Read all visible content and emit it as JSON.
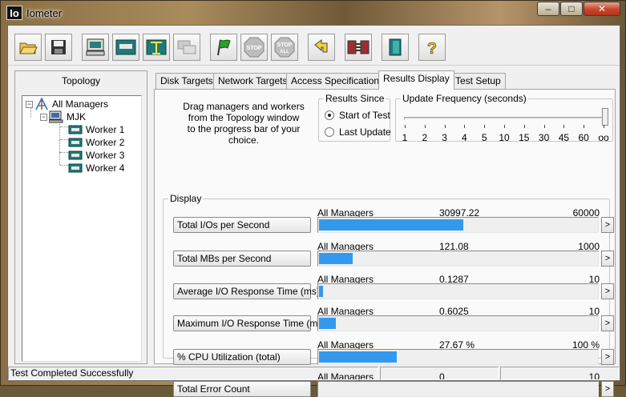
{
  "window": {
    "title": "Iometer",
    "icon_text": "Io",
    "minimize": "–",
    "maximize": "□",
    "close": "✕"
  },
  "toolbar": [
    {
      "icon": "open-folder-icon"
    },
    {
      "icon": "save-disk-icon"
    },
    {
      "icon": "new-manager-icon"
    },
    {
      "icon": "disk-worker-icon"
    },
    {
      "icon": "network-worker-icon"
    },
    {
      "icon": "duplicate-worker-icon"
    },
    {
      "icon": "start-flag-icon"
    },
    {
      "icon": "stop-icon",
      "text": "STOP"
    },
    {
      "icon": "stop-all-icon",
      "text": "STOP",
      "text2": "ALL"
    },
    {
      "icon": "reset-workers-icon"
    },
    {
      "icon": "disconnect-icon"
    },
    {
      "icon": "exit-icon"
    },
    {
      "icon": "help-icon",
      "text": "?"
    }
  ],
  "topology": {
    "title": "Topology",
    "root": "All Managers",
    "manager": "MJK",
    "workers": [
      "Worker 1",
      "Worker 2",
      "Worker 3",
      "Worker 4"
    ]
  },
  "tabs": [
    "Disk Targets",
    "Network Targets",
    "Access Specifications",
    "Results Display",
    "Test Setup"
  ],
  "active_tab": "Results Display",
  "drag_text": [
    "Drag managers and workers",
    "from the Topology window",
    "to the progress bar of your choice."
  ],
  "results_since": {
    "label": "Results Since",
    "options": [
      "Start of Test",
      "Last Update"
    ],
    "selected": "Start of Test"
  },
  "update_frequency": {
    "label": "Update Frequency (seconds)",
    "ticks": [
      "1",
      "2",
      "3",
      "4",
      "5",
      "10",
      "15",
      "30",
      "45",
      "60",
      "oo"
    ],
    "selected": "oo"
  },
  "display": {
    "label": "Display",
    "metrics": [
      {
        "button": "Total I/Os per Second",
        "target": "All Managers",
        "value": "30997.22",
        "max": "60000",
        "fraction": 0.5166
      },
      {
        "button": "Total MBs per Second",
        "target": "All Managers",
        "value": "121.08",
        "max": "1000",
        "fraction": 0.1211
      },
      {
        "button": "Average I/O Response Time (ms)",
        "target": "All Managers",
        "value": "0.1287",
        "max": "10",
        "fraction": 0.0129
      },
      {
        "button": "Maximum I/O Response Time (ms)",
        "target": "All Managers",
        "value": "0.6025",
        "max": "10",
        "fraction": 0.0603
      },
      {
        "button": "% CPU Utilization (total)",
        "target": "All Managers",
        "value": "27.67 %",
        "max": "100 %",
        "fraction": 0.2767
      },
      {
        "button": "Total Error Count",
        "target": "All Managers",
        "value": "0",
        "max": "10",
        "fraction": 0
      }
    ],
    "arrow": ">"
  },
  "status": {
    "text": "Test Completed Successfully"
  },
  "colors": {
    "bar": "#3399ee",
    "window_frame": "#a98b5c"
  }
}
